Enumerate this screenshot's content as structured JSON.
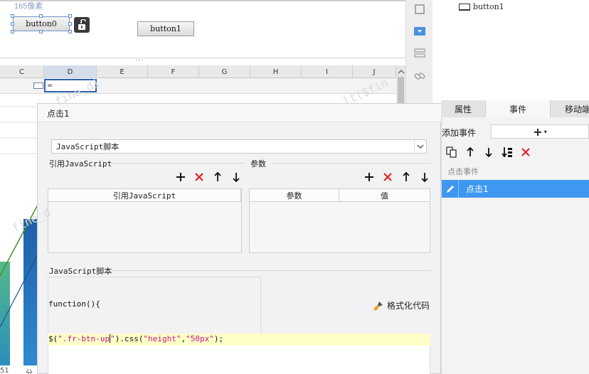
{
  "canvas": {
    "width_label": "165像素",
    "button0_label": "button0",
    "button1_label": "button1",
    "resize_dots": "···"
  },
  "sheet": {
    "columns": [
      "C",
      "D",
      "E",
      "F",
      "G",
      "H",
      "I",
      "J"
    ],
    "active_column": "D",
    "selected_cell_value": "=",
    "bottom_labels": [
      "51",
      "分"
    ]
  },
  "widget_tree": {
    "item_label": "button1"
  },
  "right_panel": {
    "tabs": [
      {
        "label": "属性",
        "active": false
      },
      {
        "label": "事件",
        "active": true
      },
      {
        "label": "移动端",
        "active": false
      }
    ],
    "add_event_label": "添加事件",
    "add_event_symbol": "+",
    "event_section_label": "点击事件",
    "event_items": [
      {
        "label": "点击1",
        "selected": true
      }
    ]
  },
  "dialog": {
    "title": "点击1",
    "type_select": {
      "value": "JavaScript脚本"
    },
    "ref_js": {
      "title": "引用JavaScript",
      "column": "引用JavaScript"
    },
    "params": {
      "title": "参数",
      "columns": [
        "参数",
        "值"
      ]
    },
    "script": {
      "title": "JavaScript脚本",
      "line1": "function(){",
      "line2_parts": [
        {
          "t": "$(",
          "k": "punc"
        },
        {
          "t": "\".fr-btn-up",
          "k": "str"
        },
        {
          "t": "CARET",
          "k": "caret"
        },
        {
          "t": "\"",
          "k": "str"
        },
        {
          "t": ").css(",
          "k": "punc"
        },
        {
          "t": "\"height\"",
          "k": "str"
        },
        {
          "t": ",",
          "k": "punc"
        },
        {
          "t": "\"50px\"",
          "k": "str"
        },
        {
          "t": ");",
          "k": "punc"
        }
      ]
    },
    "format_label": "格式化代码"
  },
  "colors": {
    "accent": "#3e97f1",
    "delete_red": "#e02424",
    "string_pink": "#c11a8b",
    "highlight_yellow": "#fdfdc8"
  }
}
